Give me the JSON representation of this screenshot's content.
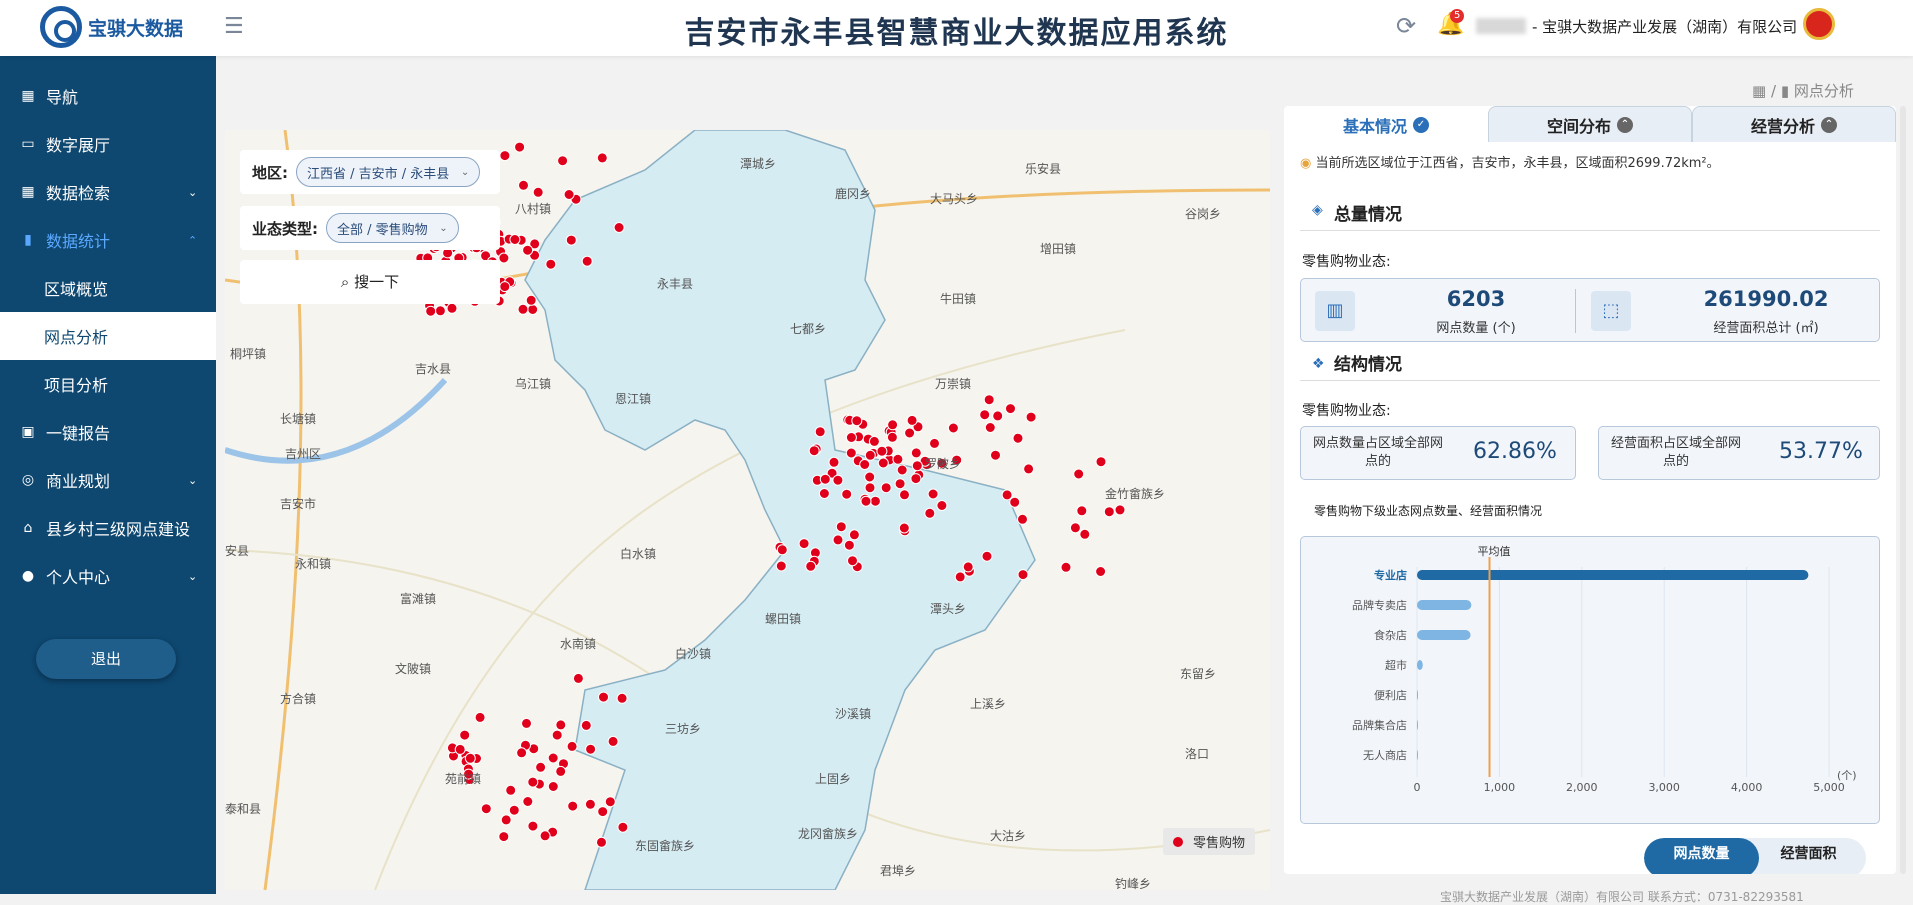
{
  "header": {
    "logo_text": "宝骐大数据",
    "title": "吉安市永丰县智慧商业大数据应用系统",
    "notification_count": "5",
    "company": "- 宝骐大数据产业发展（湖南）有限公司"
  },
  "sidebar": {
    "items": [
      {
        "label": "导航",
        "icon": "grid-icon"
      },
      {
        "label": "数字展厅",
        "icon": "monitor-icon"
      },
      {
        "label": "数据检索",
        "icon": "grid-search-icon"
      },
      {
        "label": "数据统计",
        "icon": "bar-chart-icon"
      },
      {
        "label": "一键报告",
        "icon": "clipboard-icon"
      },
      {
        "label": "商业规划",
        "icon": "map-pin-icon"
      },
      {
        "label": "县乡村三级网点建设",
        "icon": "building-icon"
      },
      {
        "label": "个人中心",
        "icon": "user-icon"
      }
    ],
    "sub_items": [
      "区域概览",
      "网点分析",
      "项目分析"
    ],
    "logout": "退出"
  },
  "breadcrumb": {
    "separator": "/",
    "current": "网点分析"
  },
  "filters": {
    "region_label": "地区:",
    "region_value": "江西省 / 吉安市 / 永丰县",
    "type_label": "业态类型:",
    "type_value": "全部 / 零售购物",
    "search": "搜一下"
  },
  "map": {
    "legend": "零售购物",
    "labels": [
      "潭城乡",
      "鹿冈乡",
      "大马头乡",
      "乐安县",
      "谷岗乡",
      "增田镇",
      "八村镇",
      "永丰县",
      "七都乡",
      "牛田镇",
      "桐坪镇",
      "吉水县",
      "乌江镇",
      "万崇镇",
      "长塘镇",
      "吉州区",
      "恩江镇",
      "罗陂乡",
      "吉安市",
      "金竹畲族乡",
      "安县",
      "白水镇",
      "永和镇",
      "富滩镇",
      "潭头乡",
      "螺田镇",
      "水南镇",
      "文陂镇",
      "白沙镇",
      "东留乡",
      "方合镇",
      "上溪乡",
      "三坊乡",
      "沙溪镇",
      "洛口",
      "苑前镇",
      "上固乡",
      "泰和县",
      "龙冈畲族乡",
      "东固畲族乡",
      "大沽乡",
      "君埠乡",
      "钓峰乡"
    ]
  },
  "panel": {
    "tabs": [
      "基本情况",
      "空间分布",
      "经营分析"
    ],
    "location_text": "当前所选区域位于江西省，吉安市，永丰县，区域面积2699.72km²。",
    "total_title": "总量情况",
    "structure_title": "结构情况",
    "category_label": "零售购物业态:",
    "outlet_count": "6203",
    "outlet_count_label": "网点数量 (个)",
    "area_total": "261990.02",
    "area_total_label": "经营面积总计 (㎡)",
    "ratio_count_label": "网点数量占区域全部网点的",
    "ratio_count_value": "62.86%",
    "ratio_area_label": "经营面积占区域全部网点的",
    "ratio_area_value": "53.77%",
    "chart_title": "零售购物下级业态网点数量、经营面积情况",
    "toggle": [
      "网点数量",
      "经营面积"
    ]
  },
  "chart_data": {
    "type": "bar",
    "orientation": "horizontal",
    "categories": [
      "专业店",
      "品牌专卖店",
      "食杂店",
      "超市",
      "便利店",
      "品牌集合店",
      "无人商店"
    ],
    "values": [
      4750,
      660,
      650,
      70,
      5,
      3,
      2
    ],
    "average_label": "平均值",
    "average": 880,
    "xlim": [
      0,
      5000
    ],
    "xticks": [
      "0",
      "1,000",
      "2,000",
      "3,000",
      "4,000",
      "5,000"
    ],
    "unit": "(个)",
    "highlight_color": "#1f6aa5",
    "bar_color": "#7fb5e2",
    "average_color": "#f0a04b"
  },
  "footer": {
    "text": "宝骐大数据产业发展（湖南）有限公司 联系方式：0731-82293581"
  }
}
